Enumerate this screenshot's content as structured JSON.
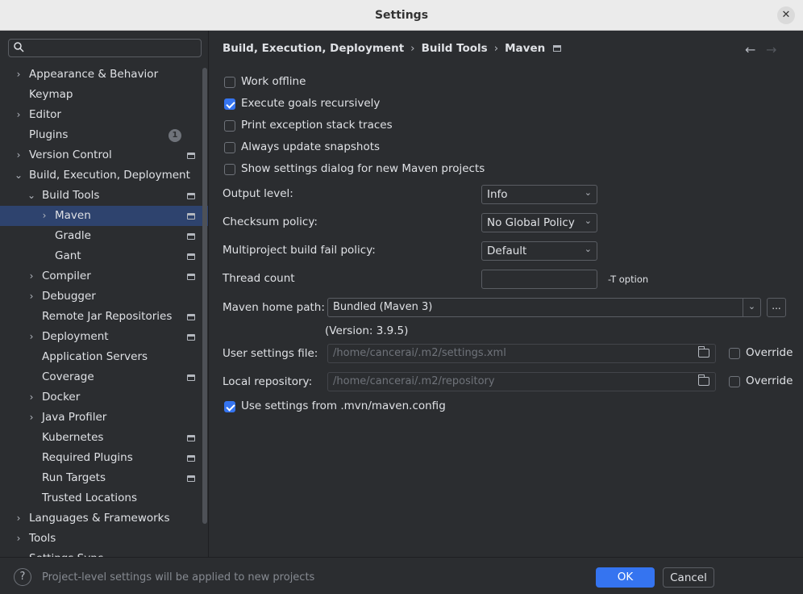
{
  "window": {
    "title": "Settings",
    "close_glyph": "✕"
  },
  "search": {
    "icon": "search-icon",
    "placeholder": ""
  },
  "sidebar": {
    "items": [
      {
        "label": "Appearance & Behavior",
        "expander": "›",
        "level": 0,
        "bold": false
      },
      {
        "label": "Keymap",
        "expander": "",
        "level": 0
      },
      {
        "label": "Editor",
        "expander": "›",
        "level": 0
      },
      {
        "label": "Plugins",
        "expander": "",
        "level": 0,
        "badge": "1"
      },
      {
        "label": "Version Control",
        "expander": "›",
        "level": 0,
        "project": true
      },
      {
        "label": "Build, Execution, Deployment",
        "expander": "⌄",
        "level": 0
      },
      {
        "label": "Build Tools",
        "expander": "⌄",
        "level": 1,
        "project": true
      },
      {
        "label": "Maven",
        "expander": "›",
        "level": 2,
        "project": true,
        "selected": true
      },
      {
        "label": "Gradle",
        "expander": "",
        "level": 2,
        "project": true
      },
      {
        "label": "Gant",
        "expander": "",
        "level": 2,
        "project": true
      },
      {
        "label": "Compiler",
        "expander": "›",
        "level": 1,
        "project": true
      },
      {
        "label": "Debugger",
        "expander": "›",
        "level": 1
      },
      {
        "label": "Remote Jar Repositories",
        "expander": "",
        "level": 1,
        "project": true
      },
      {
        "label": "Deployment",
        "expander": "›",
        "level": 1,
        "project": true
      },
      {
        "label": "Application Servers",
        "expander": "",
        "level": 1
      },
      {
        "label": "Coverage",
        "expander": "",
        "level": 1,
        "project": true
      },
      {
        "label": "Docker",
        "expander": "›",
        "level": 1
      },
      {
        "label": "Java Profiler",
        "expander": "›",
        "level": 1
      },
      {
        "label": "Kubernetes",
        "expander": "",
        "level": 1,
        "project": true
      },
      {
        "label": "Required Plugins",
        "expander": "",
        "level": 1,
        "project": true
      },
      {
        "label": "Run Targets",
        "expander": "",
        "level": 1,
        "project": true
      },
      {
        "label": "Trusted Locations",
        "expander": "",
        "level": 1
      },
      {
        "label": "Languages & Frameworks",
        "expander": "›",
        "level": 0
      },
      {
        "label": "Tools",
        "expander": "›",
        "level": 0
      },
      {
        "label": "Settings Sync",
        "expander": "",
        "level": 0
      }
    ]
  },
  "breadcrumb": {
    "part1": "Build, Execution, Deployment",
    "sep": "›",
    "part2": "Build Tools",
    "part3": "Maven",
    "back": "←",
    "forward": "→"
  },
  "options": {
    "work_offline": {
      "label": "Work offline",
      "checked": false
    },
    "execute_recursively": {
      "label": "Execute goals recursively",
      "checked": true
    },
    "print_stack_traces": {
      "label": "Print exception stack traces",
      "checked": false
    },
    "always_update": {
      "label": "Always update snapshots",
      "checked": false
    },
    "show_dialog": {
      "label": "Show settings dialog for new Maven projects",
      "checked": false
    },
    "use_mvn_config": {
      "label": "Use settings from .mvn/maven.config",
      "checked": true
    }
  },
  "fields": {
    "output_level": {
      "label": "Output level:",
      "value": "Info"
    },
    "checksum_policy": {
      "label": "Checksum policy:",
      "value": "No Global Policy"
    },
    "multiproject_policy": {
      "label": "Multiproject build fail policy:",
      "value": "Default"
    },
    "thread_count": {
      "label": "Thread count",
      "value": "",
      "hint": "-T option"
    },
    "maven_home": {
      "label": "Maven home path:",
      "value": "Bundled (Maven 3)",
      "browse": "...",
      "version": "(Version: 3.9.5)"
    },
    "user_settings": {
      "label": "User settings file:",
      "value": "/home/cancerai/.m2/settings.xml",
      "override": "Override",
      "override_checked": false
    },
    "local_repo": {
      "label": "Local repository:",
      "value": "/home/cancerai/.m2/repository",
      "override": "Override",
      "override_checked": false
    }
  },
  "footer": {
    "help": "?",
    "message": "Project-level settings will be applied to new projects",
    "ok": "OK",
    "cancel": "Cancel"
  },
  "colors": {
    "accent": "#3574f0",
    "selection": "#2e436e",
    "background": "#2b2d30"
  }
}
